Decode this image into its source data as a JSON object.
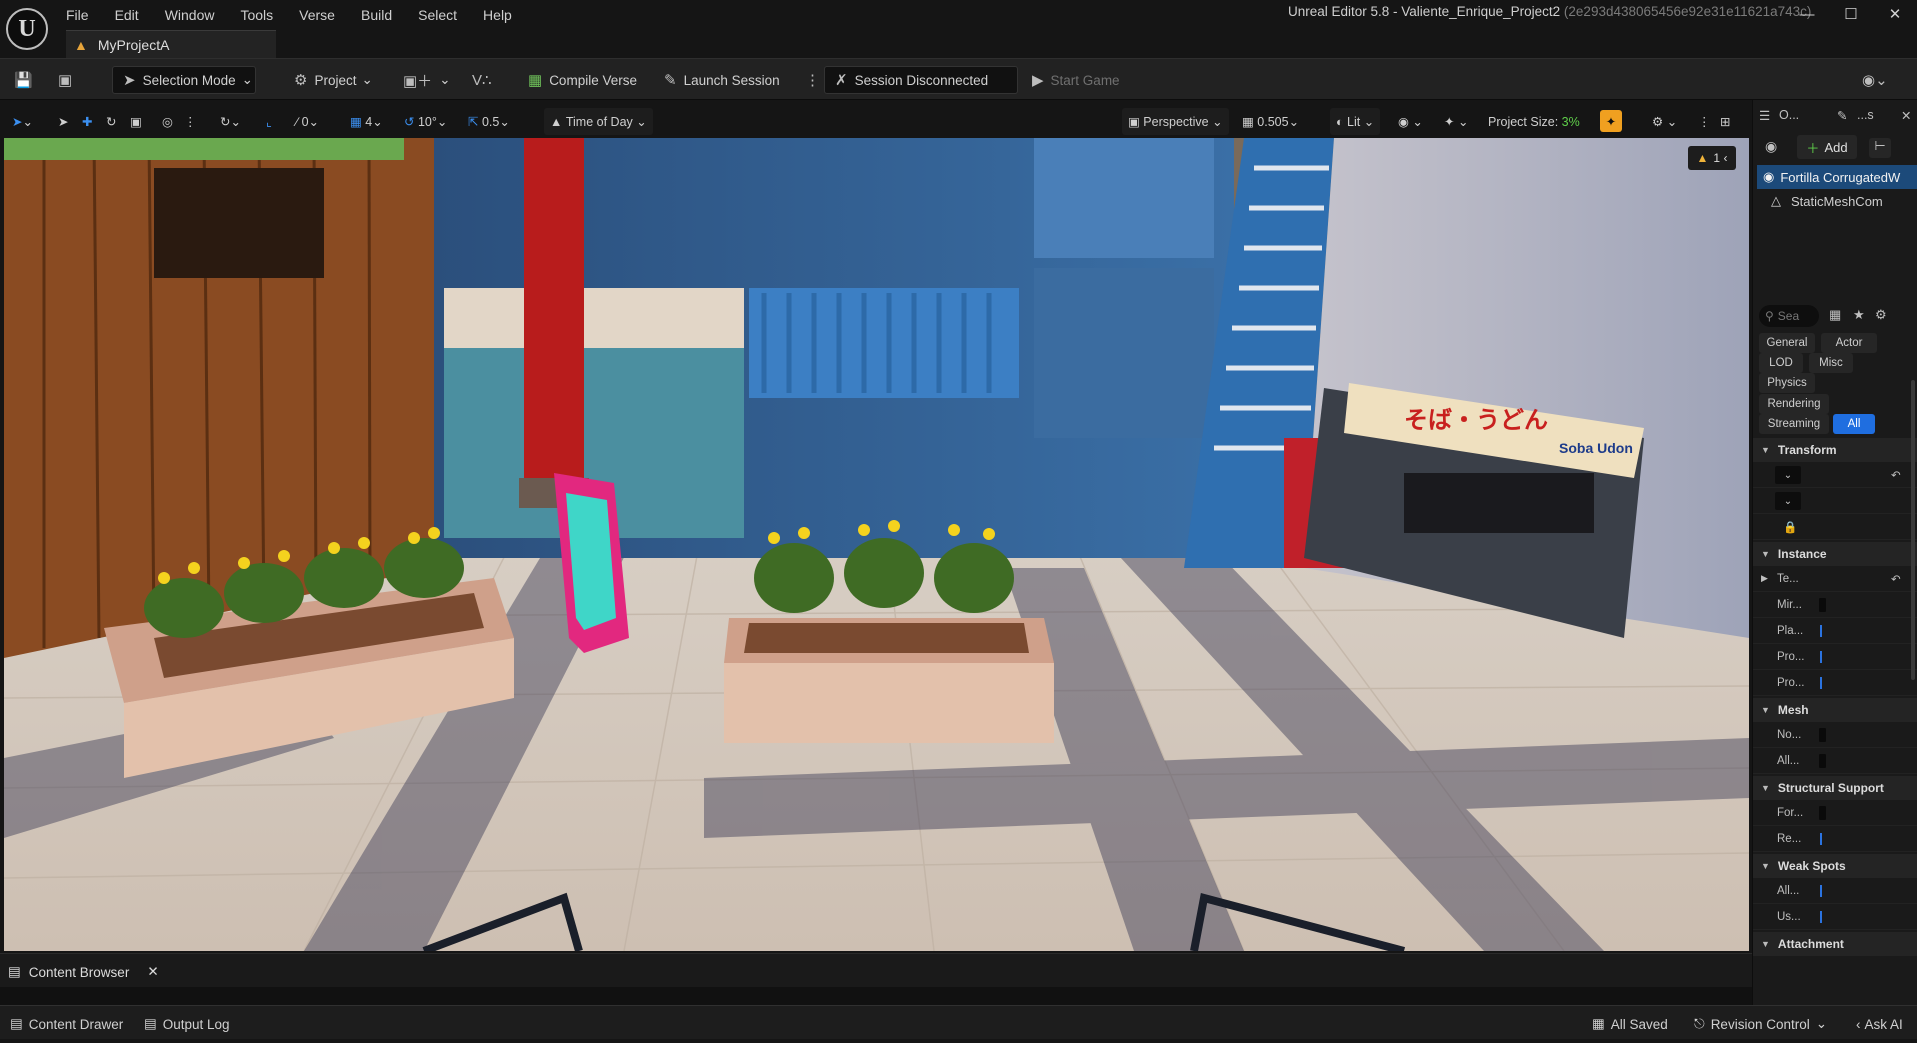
{
  "app": {
    "window_title": "Unreal Editor 5.8 - Valiente_Enrique_Project2",
    "window_hash": "(2e293d438065456e92e31e11621a743c)",
    "project_tab": "MyProjectA"
  },
  "menu": [
    "File",
    "Edit",
    "Window",
    "Tools",
    "Verse",
    "Build",
    "Select",
    "Help"
  ],
  "toolbar": {
    "selection_mode": "Selection Mode",
    "project": "Project",
    "compile_verse": "Compile Verse",
    "launch_session": "Launch Session",
    "session_status": "Session Disconnected",
    "start_game": "Start Game"
  },
  "viewport_toolbar": {
    "snap_translate": "0",
    "snap_grid": "4",
    "snap_rotate": "10°",
    "snap_scale": "0.5",
    "time_of_day": "Time of Day",
    "perspective": "Perspective",
    "camera_speed": "0.505",
    "view_mode": "Lit",
    "project_size_label": "Project Size:",
    "project_size_value": "3%",
    "warning_count": "1"
  },
  "viewport": {
    "sign_text": "そば・うどん",
    "sign_text_en": "Soba Udon"
  },
  "content_browser": {
    "tab_label": "Content Browser"
  },
  "bottom_bar": {
    "content_drawer": "Content Drawer",
    "output_log": "Output Log",
    "all_saved": "All Saved",
    "revision_control": "Revision Control",
    "ask_ai": "Ask AI"
  },
  "right_panel": {
    "tab_outliner": "O...",
    "tab_details": "...s",
    "add_button": "Add",
    "selected_actor": "Fortilla CorrugatedW",
    "component": "StaticMeshCom",
    "search_placeholder": "Sea",
    "filters": [
      "General",
      "Actor",
      "LOD",
      "Misc",
      "Physics",
      "Rendering",
      "Streaming",
      "All"
    ],
    "sections": {
      "transform": "Transform",
      "instance": "Instance",
      "mesh": "Mesh",
      "structural_support": "Structural Support",
      "weak_spots": "Weak Spots",
      "attachment": "Attachment"
    },
    "instance_props": [
      "Te...",
      "Mir...",
      "Pla...",
      "Pro...",
      "Pro..."
    ],
    "mesh_props": [
      "No...",
      "All..."
    ],
    "structural_props": [
      "For...",
      "Re..."
    ],
    "weak_spot_props": [
      "All...",
      "Us..."
    ]
  }
}
